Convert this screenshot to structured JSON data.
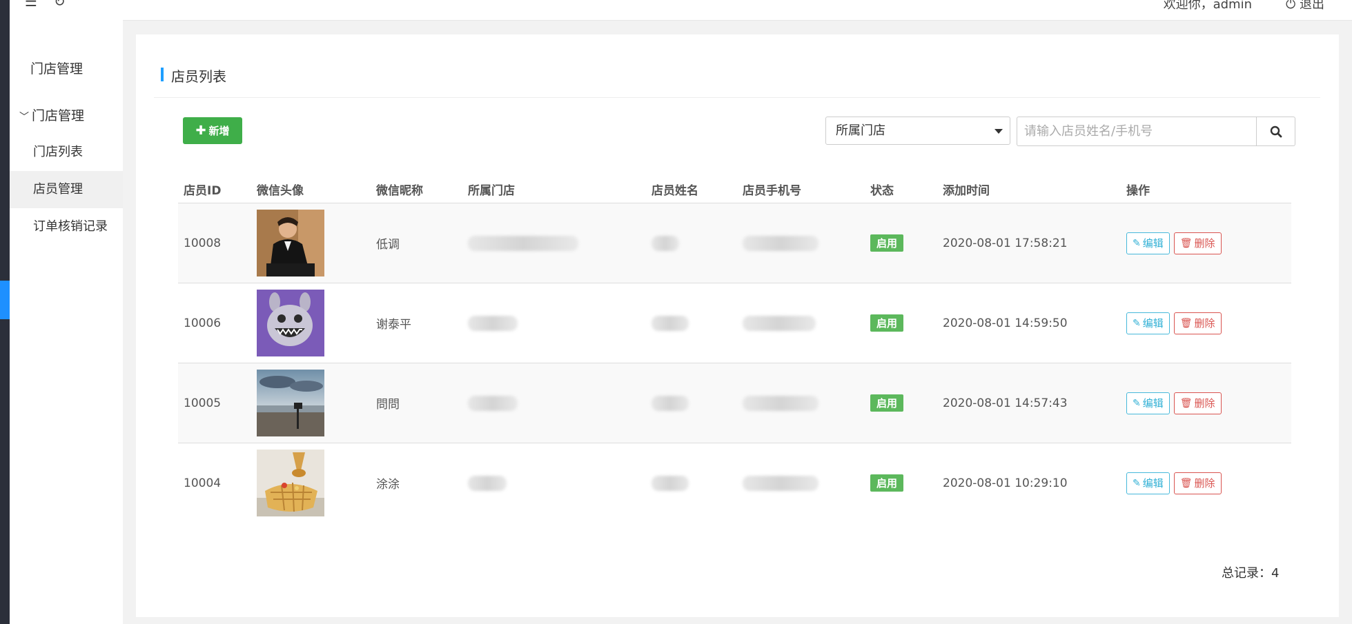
{
  "header": {
    "welcome": "欢迎你，admin",
    "logout": "退出"
  },
  "sidebar": {
    "title": "门店管理",
    "group": "门店管理",
    "items": [
      {
        "label": "门店列表",
        "active": false
      },
      {
        "label": "店员管理",
        "active": true
      },
      {
        "label": "订单核销记录",
        "active": false
      }
    ]
  },
  "panel": {
    "title": "店员列表",
    "add_label": "新增",
    "store_select": "所属门店",
    "search_placeholder": "请输入店员姓名/手机号"
  },
  "table": {
    "columns": [
      "店员ID",
      "微信头像",
      "微信昵称",
      "所属门店",
      "店员姓名",
      "店员手机号",
      "状态",
      "添加时间",
      "操作"
    ],
    "rows": [
      {
        "id": "10008",
        "avatar": "man-in-suit-photo",
        "nickname": "低调",
        "store": "",
        "name": "",
        "phone": "",
        "status": "启用",
        "added": "2020-08-01 17:58:21",
        "edit": "编辑",
        "delete": "删除"
      },
      {
        "id": "10006",
        "avatar": "purple-monster-cartoon",
        "nickname": "谢泰平",
        "store": "",
        "name": "",
        "phone": "",
        "status": "启用",
        "added": "2020-08-01 14:59:50",
        "edit": "编辑",
        "delete": "删除"
      },
      {
        "id": "10005",
        "avatar": "beach-sunset-photo",
        "nickname": "問問",
        "store": "",
        "name": "",
        "phone": "",
        "status": "启用",
        "added": "2020-08-01 14:57:43",
        "edit": "编辑",
        "delete": "删除"
      },
      {
        "id": "10004",
        "avatar": "honey-waffle-photo",
        "nickname": "涂涂",
        "store": "",
        "name": "",
        "phone": "",
        "status": "启用",
        "added": "2020-08-01 10:29:10",
        "edit": "编辑",
        "delete": "删除"
      }
    ]
  },
  "footer": {
    "total": "总记录：4"
  },
  "colors": {
    "accent": "#1e9fff",
    "add_button": "#3fae49",
    "status_badge": "#5cb85c",
    "edit": "#31b0d5",
    "delete": "#d9534f"
  }
}
